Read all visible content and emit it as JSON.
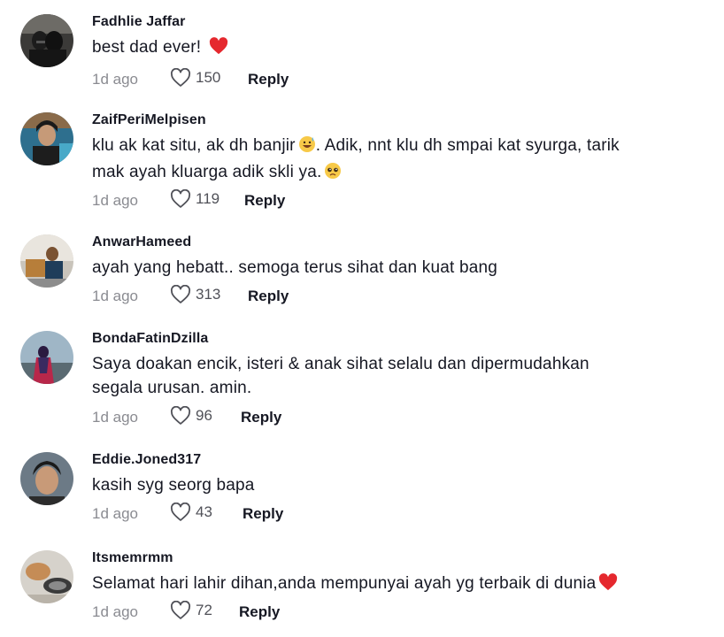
{
  "comments": [
    {
      "username": "Fadhlie Jaffar",
      "text": "best dad ever!",
      "time": "1d ago",
      "likes": "150",
      "reply_label": "Reply"
    },
    {
      "username": "ZaifPeriMelpisen",
      "text_line1": "klu ak kat situ, ak dh banjir",
      "text_line1b": ". Adik, nnt klu dh smpai kat syurga, tarik",
      "text_line2": "mak ayah kluarga adik skli ya.",
      "time": "1d ago",
      "likes": "119",
      "reply_label": "Reply"
    },
    {
      "username": "AnwarHameed",
      "text": "ayah yang hebatt.. semoga terus sihat dan kuat bang",
      "time": "1d ago",
      "likes": "313",
      "reply_label": "Reply"
    },
    {
      "username": "BondaFatinDzilla",
      "text_line1": "Saya doakan encik, isteri & anak sihat selalu dan dipermudahkan",
      "text_line2": "segala urusan. amin.",
      "time": "1d ago",
      "likes": "96",
      "reply_label": "Reply"
    },
    {
      "username": "Eddie.Joned317",
      "text": "kasih syg seorg bapa",
      "time": "1d ago",
      "likes": "43",
      "reply_label": "Reply"
    },
    {
      "username": "Itsmemrmm",
      "text": "Selamat hari lahir dihan,anda mempunyai ayah yg terbaik di dunia",
      "time": "1d ago",
      "likes": "72",
      "reply_label": "Reply"
    }
  ],
  "icons": {
    "like": "heart-outline-icon",
    "heart_emoji": "red-heart-emoji",
    "sweat_emoji": "grinning-sweat-emoji",
    "pleading_emoji": "pleading-face-emoji"
  },
  "colors": {
    "text": "#161823",
    "muted": "#8a8b91",
    "heart": "#e5282e"
  }
}
